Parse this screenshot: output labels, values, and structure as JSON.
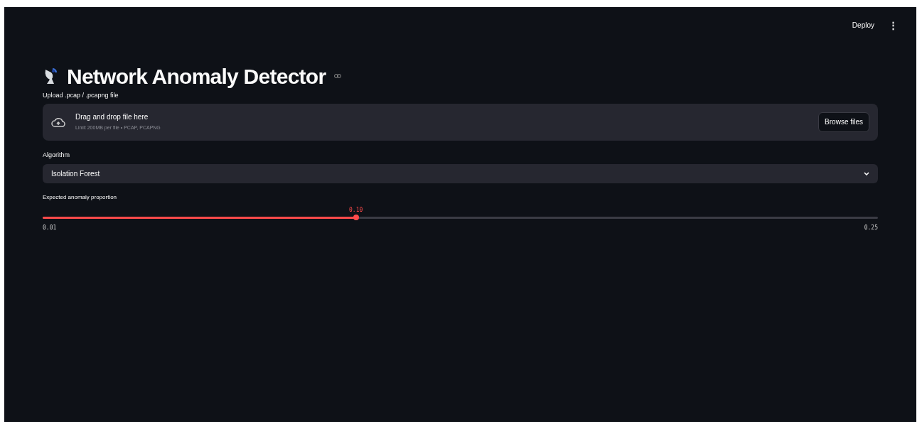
{
  "header": {
    "deploy": "Deploy",
    "menu": "⋮"
  },
  "title": "Network Anomaly Detector",
  "uploader": {
    "label": "Upload .pcap / .pcapng file",
    "prompt": "Drag and drop file here",
    "hint": "Limit 200MB per file • PCAP, PCAPNG",
    "button": "Browse files"
  },
  "algorithm": {
    "label": "Algorithm",
    "value": "Isolation Forest"
  },
  "slider": {
    "label": "Expected anomaly proportion",
    "reading": "0.10",
    "level": 0.375,
    "min": "0.01",
    "max": "0.25"
  }
}
